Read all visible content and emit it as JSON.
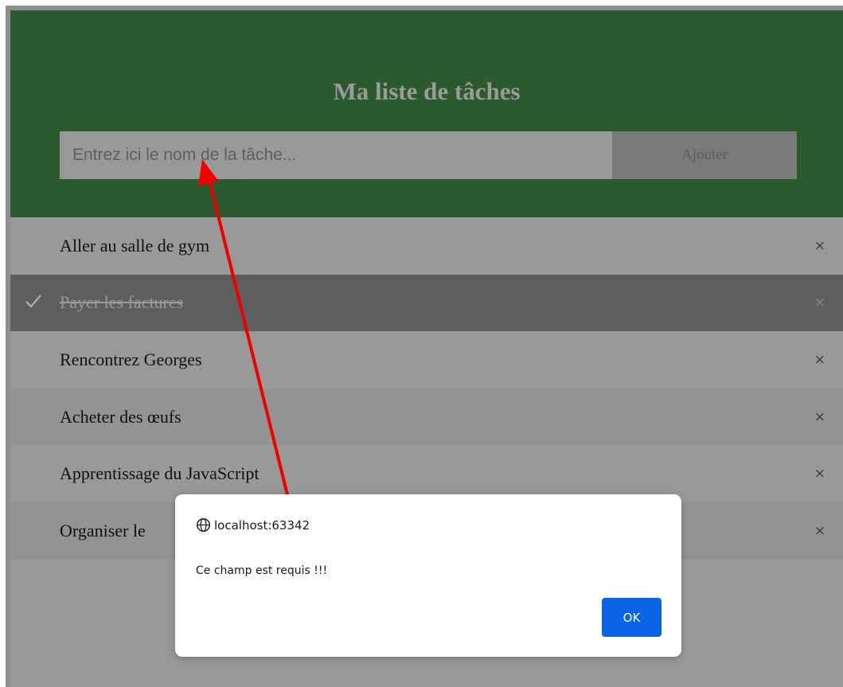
{
  "header": {
    "title": "Ma liste de tâches",
    "input_placeholder": "Entrez ici le nom de la tâche...",
    "input_value": "",
    "add_label": "Ajouter"
  },
  "tasks": [
    {
      "label": "Aller au salle de gym",
      "checked": false,
      "close_glyph": "×"
    },
    {
      "label": "Payer les factures",
      "checked": true,
      "close_glyph": "×"
    },
    {
      "label": "Rencontrez Georges",
      "checked": false,
      "close_glyph": "×"
    },
    {
      "label": "Acheter des œufs",
      "checked": false,
      "close_glyph": "×"
    },
    {
      "label": "Apprentissage du JavaScript",
      "checked": false,
      "close_glyph": "×"
    },
    {
      "label": "Organiser le",
      "checked": false,
      "close_glyph": "×"
    }
  ],
  "alert": {
    "origin": "localhost:63342",
    "message": "Ce champ est requis !!!",
    "ok_label": "OK"
  },
  "icons": {
    "check": "check-icon",
    "close": "close-icon",
    "globe": "globe-icon"
  },
  "colors": {
    "header_bg": "#2a5a2e",
    "checked_bg": "#5e5e5e",
    "ok_button": "#0b63e6",
    "arrow": "#ee0000"
  }
}
